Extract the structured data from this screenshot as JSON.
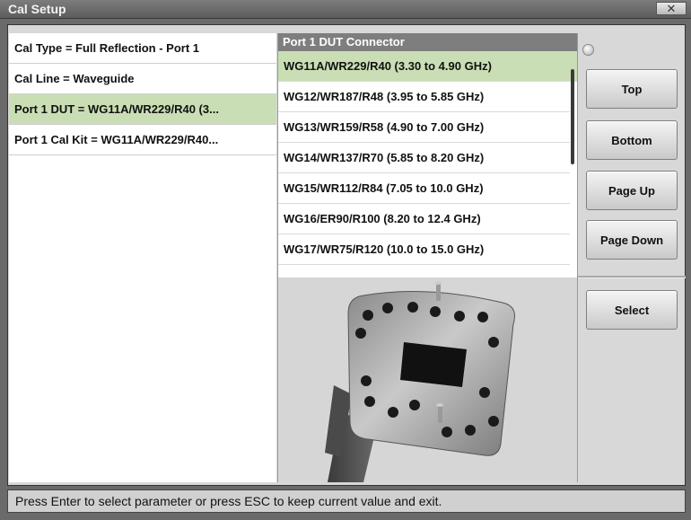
{
  "window": {
    "title": "Cal Setup",
    "close_label": "✕"
  },
  "parameters": [
    {
      "label": "Cal Type = Full Reflection - Port 1"
    },
    {
      "label": "Cal Line = Waveguide"
    },
    {
      "label": "Port 1 DUT = WG11A/WR229/R40 (3..."
    },
    {
      "label": "Port 1 Cal Kit = WG11A/WR229/R40..."
    }
  ],
  "selected_parameter_index": 2,
  "list": {
    "header": "Port 1 DUT Connector",
    "items": [
      {
        "label": "WG11A/WR229/R40 (3.30 to 4.90 GHz)"
      },
      {
        "label": "WG12/WR187/R48 (3.95 to 5.85 GHz)"
      },
      {
        "label": "WG13/WR159/R58 (4.90 to 7.00 GHz)"
      },
      {
        "label": "WG14/WR137/R70 (5.85 to 8.20 GHz)"
      },
      {
        "label": "WG15/WR112/R84 (7.05 to 10.0 GHz)"
      },
      {
        "label": "WG16/ER90/R100 (8.20 to 12.4 GHz)"
      },
      {
        "label": "WG17/WR75/R120 (10.0 to 15.0 GHz)"
      }
    ],
    "selected_index": 0
  },
  "buttons": {
    "top": "Top",
    "bottom": "Bottom",
    "page_up": "Page Up",
    "page_down": "Page Down",
    "select": "Select"
  },
  "status": "Press Enter to select parameter or press ESC to keep current value and exit.",
  "colors": {
    "selected_row": "#c9deb4",
    "header": "#7e7e7e"
  }
}
